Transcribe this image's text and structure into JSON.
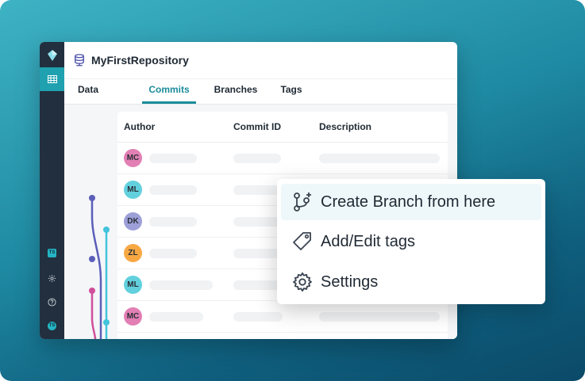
{
  "repository": {
    "name": "MyFirstRepository"
  },
  "tabs": [
    {
      "label": "Data"
    },
    {
      "label": "Commits"
    },
    {
      "label": "Branches"
    },
    {
      "label": "Tags"
    }
  ],
  "active_tab": "Commits",
  "sidebar": {
    "icons": [
      "logo-icon",
      "grid-icon",
      "ts-badge-icon",
      "gear-icon",
      "help-icon",
      "ts-avatar-icon"
    ],
    "ts_label": "TS"
  },
  "table": {
    "columns": [
      "Author",
      "Commit ID",
      "Description"
    ],
    "rows": [
      {
        "initials": "MC",
        "color": "#e27fb4"
      },
      {
        "initials": "ML",
        "color": "#62d0dd"
      },
      {
        "initials": "DK",
        "color": "#9d9fd8"
      },
      {
        "initials": "ZL",
        "color": "#f7a843"
      },
      {
        "initials": "ML",
        "color": "#62d0dd"
      },
      {
        "initials": "MC",
        "color": "#e27fb4"
      }
    ]
  },
  "context_menu": {
    "items": [
      {
        "label": "Create Branch from here",
        "icon": "branch-icon"
      },
      {
        "label": "Add/Edit tags",
        "icon": "tag-icon"
      },
      {
        "label": "Settings",
        "icon": "gear-icon"
      }
    ]
  },
  "colors": {
    "accent": "#1a8c9a",
    "sidebar": "#222f3e",
    "branch_main": "#5b5fb8",
    "branch_cyan": "#42c4dc",
    "branch_pink": "#d14f9b",
    "branch_orange": "#f7a07a"
  }
}
